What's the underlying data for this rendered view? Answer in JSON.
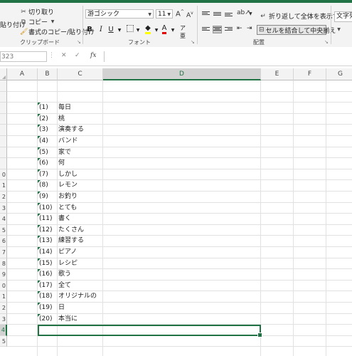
{
  "ribbon": {
    "clipboard": {
      "paste_label": "貼り付け",
      "cut_label": "切り取り",
      "copy_label": "コピー",
      "format_painter_label": "書式のコピー/貼り付け",
      "group_label": "クリップボード"
    },
    "font": {
      "font_name": "游ゴシック",
      "font_size": "11",
      "grow_label": "A",
      "shrink_label": "A",
      "bold_label": "B",
      "italic_label": "I",
      "underline_label": "U",
      "font_color_label": "A",
      "group_label": "フォント"
    },
    "alignment": {
      "wrap_text_label": "折り返して全体を表示する",
      "merge_center_label": "セルを結合して中央揃え",
      "group_label": "配置"
    },
    "number": {
      "format_label": "文字列"
    }
  },
  "formula_bar": {
    "name_box": "323",
    "fx_label": "fx",
    "content": ""
  },
  "columns": [
    "A",
    "B",
    "C",
    "D",
    "E",
    "F",
    "G"
  ],
  "selected_column": "D",
  "row_numbers": [
    "",
    "",
    "",
    "",
    "",
    "",
    "",
    "",
    "0",
    "1",
    "2",
    "3",
    "4",
    "5",
    "6",
    "7",
    "8",
    "9",
    "0",
    "1",
    "2",
    "3",
    "4",
    "5"
  ],
  "selected_row": "3",
  "list_rows": [
    {
      "num": "(1)",
      "word": "毎日"
    },
    {
      "num": "(2)",
      "word": "桃"
    },
    {
      "num": "(3)",
      "word": "演奏する"
    },
    {
      "num": "(4)",
      "word": "バンド"
    },
    {
      "num": "(5)",
      "word": "家で"
    },
    {
      "num": "(6)",
      "word": "何"
    },
    {
      "num": "(7)",
      "word": "しかし"
    },
    {
      "num": "(8)",
      "word": "レモン"
    },
    {
      "num": "(9)",
      "word": "お釣り"
    },
    {
      "num": "(10)",
      "word": "とても"
    },
    {
      "num": "(11)",
      "word": "書く"
    },
    {
      "num": "(12)",
      "word": "たくさん"
    },
    {
      "num": "(13)",
      "word": "練習する"
    },
    {
      "num": "(14)",
      "word": "ピアノ"
    },
    {
      "num": "(15)",
      "word": "レシピ"
    },
    {
      "num": "(16)",
      "word": "歌う"
    },
    {
      "num": "(17)",
      "word": "全て"
    },
    {
      "num": "(18)",
      "word": "オリジナルの"
    },
    {
      "num": "(19)",
      "word": "日"
    },
    {
      "num": "(20)",
      "word": "本当に"
    }
  ]
}
